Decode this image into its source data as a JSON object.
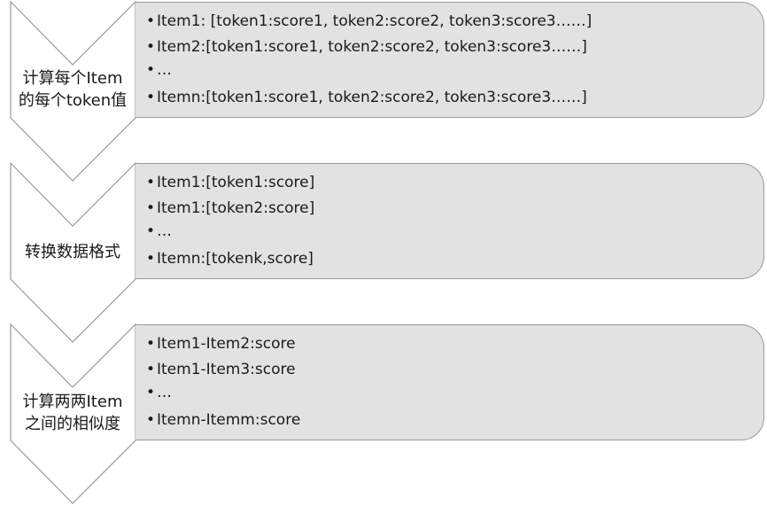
{
  "steps": [
    {
      "label_lines": [
        "计算每个Item",
        "的每个token值"
      ],
      "items": [
        "Item1: [token1:score1, token2:score2, token3:score3……]",
        "Item2:[token1:score1, token2:score2, token3:score3……]",
        "…",
        "Itemn:[token1:score1, token2:score2, token3:score3……]"
      ]
    },
    {
      "label_lines": [
        "转换数据格式"
      ],
      "items": [
        "Item1:[token1:score]",
        "Item1:[token2:score]",
        "…",
        "Itemn:[tokenk,score]"
      ]
    },
    {
      "label_lines": [
        "计算两两Item",
        "之间的相似度"
      ],
      "items": [
        "Item1-Item2:score",
        "Item1-Item3:score",
        "…",
        "Itemn-Itemm:score"
      ]
    }
  ],
  "bullet": "•"
}
